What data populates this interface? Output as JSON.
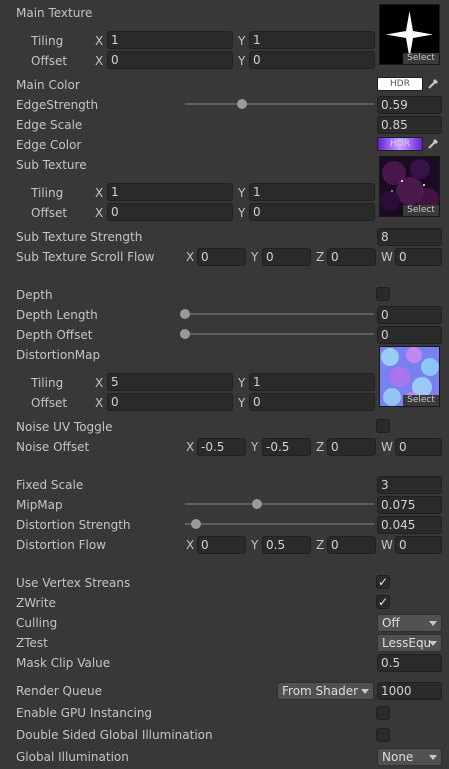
{
  "main_texture": {
    "label": "Main Texture",
    "tiling_label": "Tiling",
    "offset_label": "Offset",
    "tiling": {
      "x": "1",
      "y": "1"
    },
    "offset": {
      "x": "0",
      "y": "0"
    },
    "select_label": "Select"
  },
  "main_color": {
    "label": "Main Color",
    "hdr_label": "HDR",
    "color": "#ffffff"
  },
  "edge_strength": {
    "label": "EdgeStrength",
    "value": "0.59",
    "fraction": 0.3
  },
  "edge_scale": {
    "label": "Edge Scale",
    "value": "0.85"
  },
  "edge_color": {
    "label": "Edge Color",
    "hdr_label": "HDR",
    "color": "#8b3ff0"
  },
  "sub_texture": {
    "label": "Sub Texture",
    "tiling_label": "Tiling",
    "offset_label": "Offset",
    "tiling": {
      "x": "1",
      "y": "1"
    },
    "offset": {
      "x": "0",
      "y": "0"
    },
    "select_label": "Select"
  },
  "sub_texture_strength": {
    "label": "Sub Texture Strength",
    "value": "8"
  },
  "sub_texture_scroll_flow": {
    "label": "Sub Texture Scroll Flow",
    "x": "0",
    "y": "0",
    "z": "0",
    "w": "0"
  },
  "depth": {
    "label": "Depth",
    "checked": false
  },
  "depth_length": {
    "label": "Depth Length",
    "value": "0",
    "fraction": 0
  },
  "depth_offset": {
    "label": "Depth Offset",
    "value": "0",
    "fraction": 0
  },
  "distortion_map": {
    "label": "DistortionMap",
    "tiling_label": "Tiling",
    "offset_label": "Offset",
    "tiling": {
      "x": "5",
      "y": "1"
    },
    "offset": {
      "x": "0",
      "y": "0"
    },
    "select_label": "Select"
  },
  "noise_uv_toggle": {
    "label": "Noise UV Toggle",
    "checked": false
  },
  "noise_offset": {
    "label": "Noise Offset",
    "x": "-0.5",
    "y": "-0.5",
    "z": "0",
    "w": "0"
  },
  "fixed_scale": {
    "label": "Fixed Scale",
    "value": "3"
  },
  "mipmap": {
    "label": "MipMap",
    "value": "0.075",
    "fraction": 0.38
  },
  "distortion_strength": {
    "label": "Distortion Strength",
    "value": "0.045",
    "fraction": 0.06
  },
  "distortion_flow": {
    "label": "Distortion Flow",
    "x": "0",
    "y": "0.5",
    "z": "0",
    "w": "0"
  },
  "use_vertex_streams": {
    "label": "Use Vertex Streans",
    "checked": true
  },
  "zwrite": {
    "label": "ZWrite",
    "checked": true
  },
  "culling": {
    "label": "Culling",
    "value": "Off"
  },
  "ztest": {
    "label": "ZTest",
    "value": "LessEqu"
  },
  "mask_clip_value": {
    "label": "Mask Clip Value",
    "value": "0.5"
  },
  "render_queue": {
    "label": "Render Queue",
    "mode": "From Shader",
    "value": "1000"
  },
  "enable_gpu_instancing": {
    "label": "Enable GPU Instancing",
    "checked": false
  },
  "double_sided_gi": {
    "label": "Double Sided Global Illumination",
    "checked": false
  },
  "global_illumination": {
    "label": "Global Illumination",
    "value": "None"
  },
  "axis": {
    "x": "X",
    "y": "Y",
    "z": "Z",
    "w": "W"
  },
  "check_glyph": "✓",
  "colors": {
    "background": "#383838",
    "field": "#2a2a2a",
    "text": "#c4c4c4"
  }
}
